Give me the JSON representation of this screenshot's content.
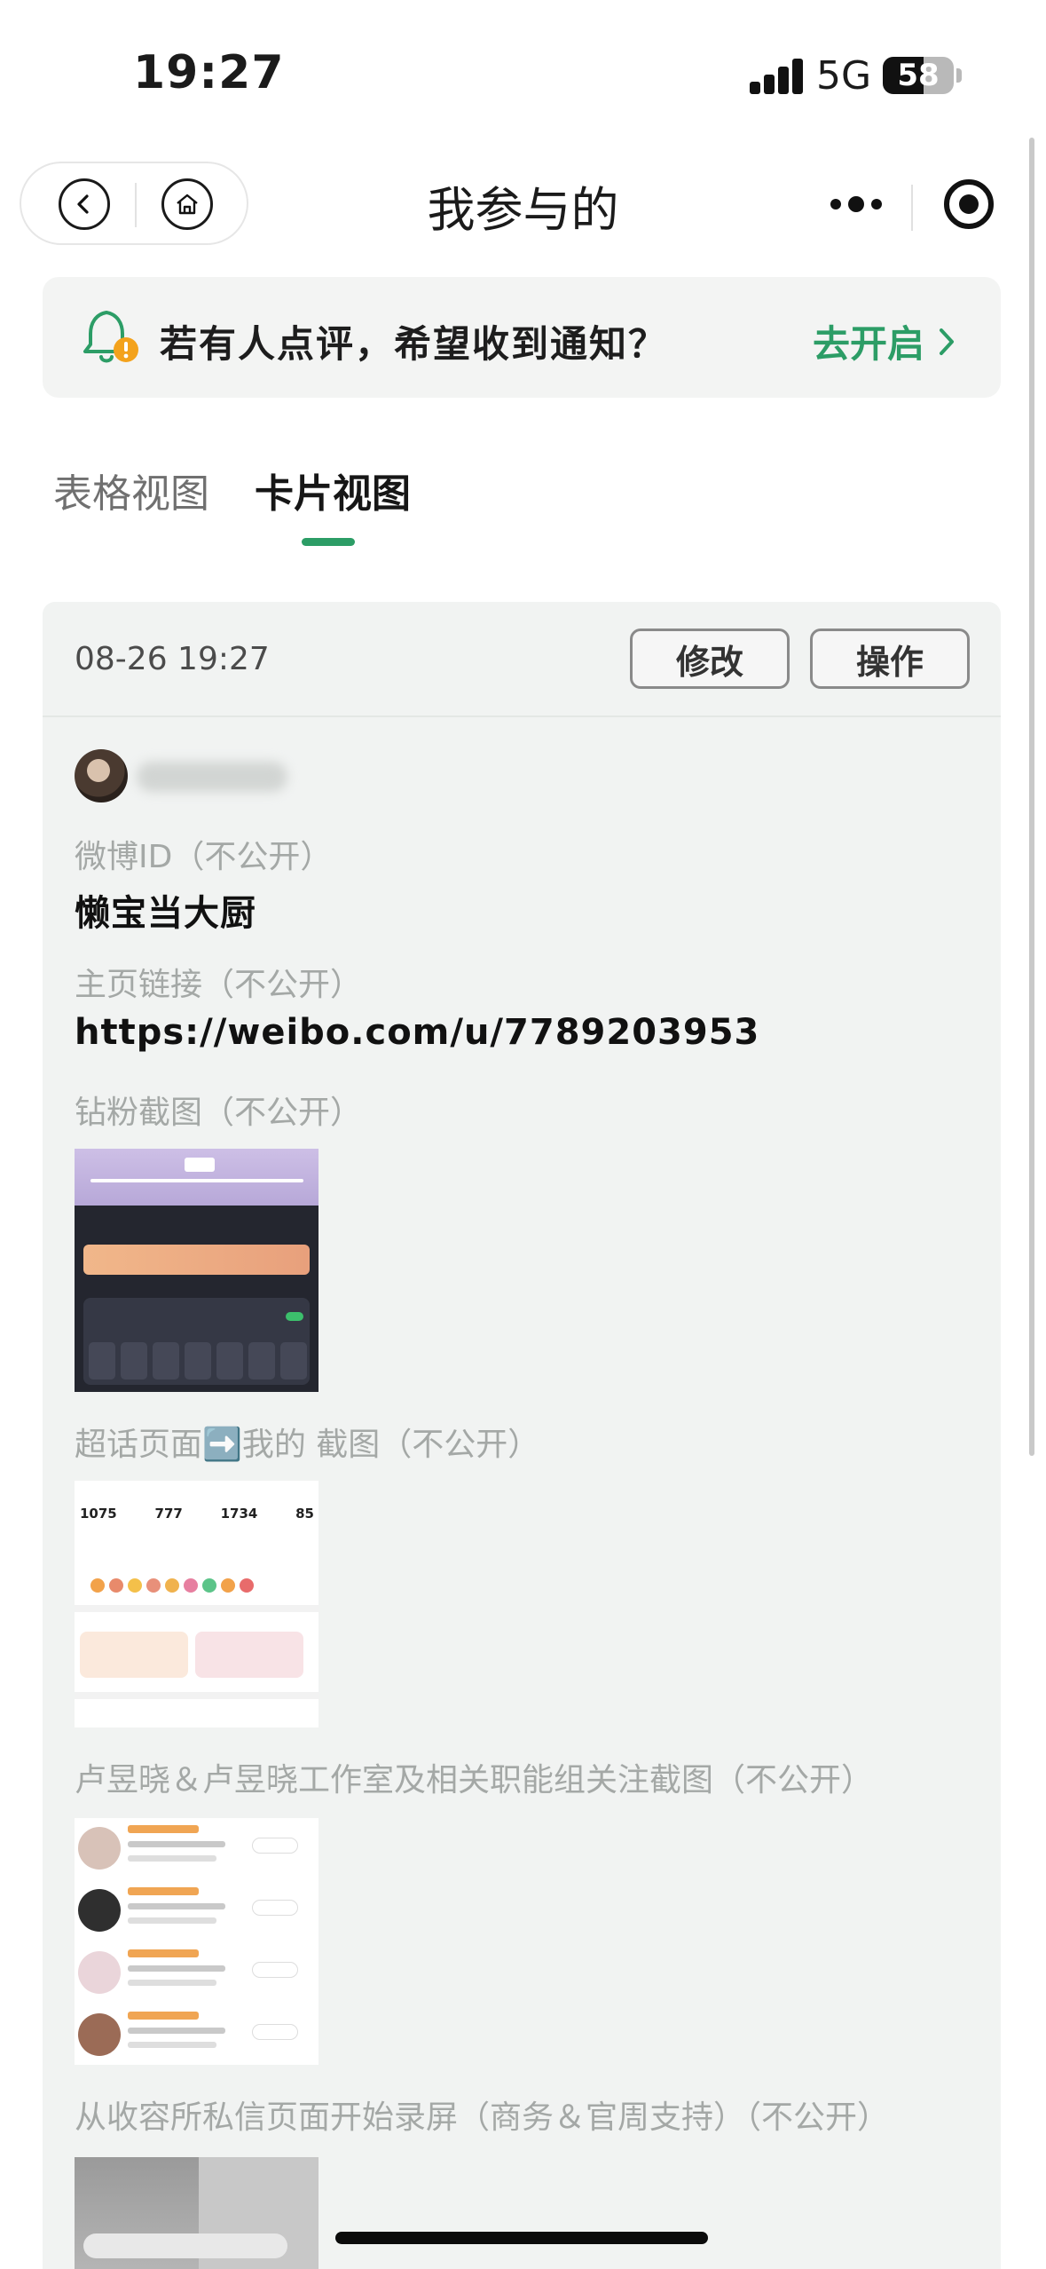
{
  "status_bar": {
    "time": "19:27",
    "network": "5G",
    "battery": "58",
    "battery_level": 0.58,
    "icons": [
      "cellular-signal-icon",
      "battery-icon"
    ]
  },
  "nav": {
    "title": "我参与的",
    "icons": [
      "chevron-left-icon",
      "home-icon",
      "more-dots-icon",
      "target-icon"
    ]
  },
  "notice": {
    "text": "若有人点评，希望收到通知？",
    "action": "去开启",
    "icon": "bell-alert-icon",
    "accent": "#2c9d66"
  },
  "tabs": [
    {
      "label": "表格视图",
      "active": false
    },
    {
      "label": "卡片视图",
      "active": true
    }
  ],
  "card": {
    "timestamp": "08-26 19:27",
    "edit_label": "修改",
    "ops_label": "操作",
    "fields": [
      {
        "label": "微博ID（不公开）",
        "value": "懒宝当大厨"
      },
      {
        "label": "主页链接（不公开）",
        "value": "https://weibo.com/u/7789203953"
      },
      {
        "label": "钻粉截图（不公开）"
      },
      {
        "label": "超话页面➡️我的 截图（不公开）"
      },
      {
        "label": "卢昱晓＆卢昱晓工作室及相关职能组关注截图（不公开）"
      },
      {
        "label": "从收容所私信页面开始录屏（商务＆官周支持）（不公开）"
      }
    ]
  },
  "colors": {
    "accent": "#2c9d66",
    "card_bg": "#f1f3f2",
    "label": "#a4a8a6"
  }
}
